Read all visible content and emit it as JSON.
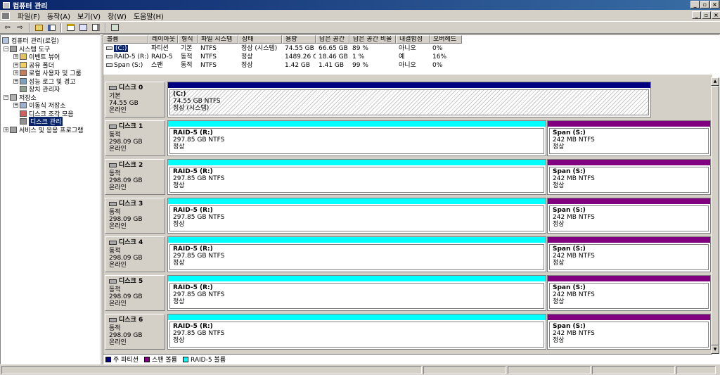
{
  "window": {
    "title": "컴퓨터 관리",
    "buttons": {
      "minimize": "_",
      "maximize": "□",
      "close": "×",
      "restore": "▫"
    }
  },
  "menu": [
    "파일(F)",
    "동작(A)",
    "보기(V)",
    "창(W)",
    "도움말(H)"
  ],
  "toolbar": {
    "back": "⇦",
    "forward": "⇨"
  },
  "tree": {
    "root": "컴퓨터 관리(로컬)",
    "system_tools": "시스템 도구",
    "event_viewer": "이벤트 뷰어",
    "shared_folders": "공유 폴더",
    "local_users": "로컬 사용자 및 그룹",
    "perf_logs": "성능 로그 및 경고",
    "device_manager": "장치 관리자",
    "storage": "저장소",
    "removable_storage": "이동식 저장소",
    "defrag": "디스크 조각 모음",
    "disk_mgmt": "디스크 관리",
    "services": "서비스 및 응용 프로그램"
  },
  "volume_list": {
    "columns": [
      "볼륨",
      "레이아웃",
      "형식",
      "파일 시스템",
      "상태",
      "용량",
      "남은 공간",
      "남은 공간 비율",
      "내결함성",
      "오버헤드"
    ],
    "rows": [
      [
        "(C:)",
        "파티션",
        "기본",
        "NTFS",
        "정상 (시스템)",
        "74.55 GB",
        "66.65 GB",
        "89 %",
        "아니오",
        "0%"
      ],
      [
        "RAID-5 (R:)",
        "RAID-5",
        "동적",
        "NTFS",
        "정상",
        "1489.26 GB",
        "18.46 GB",
        "1 %",
        "예",
        "16%"
      ],
      [
        "Span (S:)",
        "스팬",
        "동적",
        "NTFS",
        "정상",
        "1.42 GB",
        "1.41 GB",
        "99 %",
        "아니오",
        "0%"
      ]
    ]
  },
  "disks": [
    {
      "name": "디스크 0",
      "type": "기본",
      "size": "74.55 GB",
      "status": "온라인",
      "partitions": [
        {
          "name": "(C:)",
          "detail": "74.55 GB NTFS",
          "status": "정상 (시스템)"
        }
      ]
    },
    {
      "name": "디스크 1",
      "type": "동적",
      "size": "298.09 GB",
      "status": "온라인",
      "partitions": [
        {
          "name": "RAID-5  (R:)",
          "detail": "297.85 GB NTFS",
          "status": "정상"
        },
        {
          "name": "Span  (S:)",
          "detail": "242 MB NTFS",
          "status": "정상"
        }
      ]
    },
    {
      "name": "디스크 2",
      "type": "동적",
      "size": "298.09 GB",
      "status": "온라인",
      "partitions": [
        {
          "name": "RAID-5  (R:)",
          "detail": "297.85 GB NTFS",
          "status": "정상"
        },
        {
          "name": "Span  (S:)",
          "detail": "242 MB NTFS",
          "status": "정상"
        }
      ]
    },
    {
      "name": "디스크 3",
      "type": "동적",
      "size": "298.09 GB",
      "status": "온라인",
      "partitions": [
        {
          "name": "RAID-5  (R:)",
          "detail": "297.85 GB NTFS",
          "status": "정상"
        },
        {
          "name": "Span  (S:)",
          "detail": "242 MB NTFS",
          "status": "정상"
        }
      ]
    },
    {
      "name": "디스크 4",
      "type": "동적",
      "size": "298.09 GB",
      "status": "온라인",
      "partitions": [
        {
          "name": "RAID-5  (R:)",
          "detail": "297.85 GB NTFS",
          "status": "정상"
        },
        {
          "name": "Span  (S:)",
          "detail": "242 MB NTFS",
          "status": "정상"
        }
      ]
    },
    {
      "name": "디스크 5",
      "type": "동적",
      "size": "298.09 GB",
      "status": "온라인",
      "partitions": [
        {
          "name": "RAID-5  (R:)",
          "detail": "297.85 GB NTFS",
          "status": "정상"
        },
        {
          "name": "Span  (S:)",
          "detail": "242 MB NTFS",
          "status": "정상"
        }
      ]
    },
    {
      "name": "디스크 6",
      "type": "동적",
      "size": "298.09 GB",
      "status": "온라인",
      "partitions": [
        {
          "name": "RAID-5  (R:)",
          "detail": "297.85 GB NTFS",
          "status": "정상"
        },
        {
          "name": "Span  (S:)",
          "detail": "242 MB NTFS",
          "status": "정상"
        }
      ]
    }
  ],
  "legend": [
    {
      "label": "주 파티션",
      "color": "#000080"
    },
    {
      "label": "스팬 볼륨",
      "color": "#800080"
    },
    {
      "label": "RAID-5 볼륨",
      "color": "#00ffff"
    }
  ],
  "colors": {
    "primary": "#000080",
    "span": "#800080",
    "raid5": "#00ffff"
  }
}
